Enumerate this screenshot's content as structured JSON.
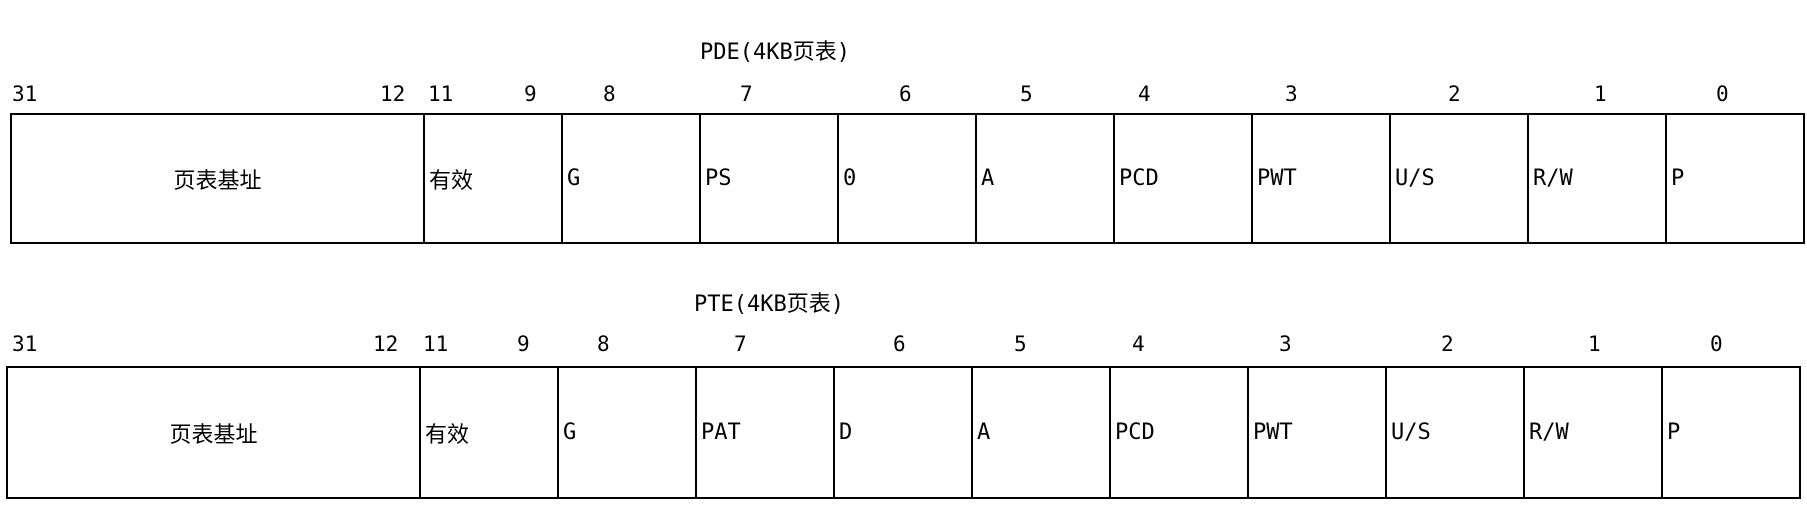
{
  "pde": {
    "title": "PDE(4KB页表)",
    "bit_numbers": [
      "31",
      "12",
      "11",
      "9",
      "8",
      "7",
      "6",
      "5",
      "4",
      "3",
      "2",
      "1",
      "0"
    ],
    "fields": [
      "页表基址",
      "有效",
      "G",
      "PS",
      "0",
      "A",
      "PCD",
      "PWT",
      "U/S",
      "R/W",
      "P"
    ]
  },
  "pte": {
    "title": "PTE(4KB页表)",
    "bit_numbers": [
      "31",
      "12",
      "11",
      "9",
      "8",
      "7",
      "6",
      "5",
      "4",
      "3",
      "2",
      "1",
      "0"
    ],
    "fields": [
      "页表基址",
      "有效",
      "G",
      "PAT",
      "D",
      "A",
      "PCD",
      "PWT",
      "U/S",
      "R/W",
      "P"
    ]
  }
}
